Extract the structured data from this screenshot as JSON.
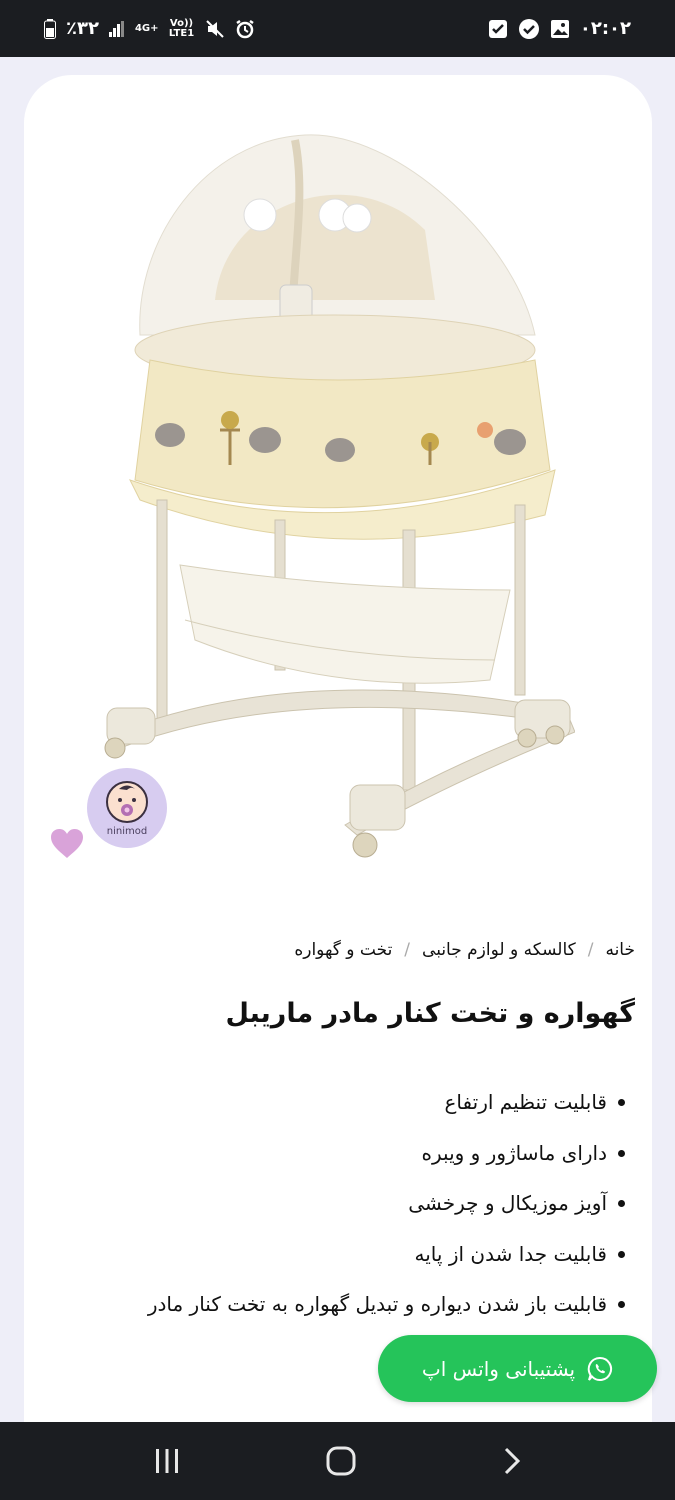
{
  "status_bar": {
    "battery_percent": "٪۳۲",
    "network": "4G+",
    "volte": "Vo)) LTE1",
    "time": "۰۲:۰۲"
  },
  "product": {
    "image_alt": "ninimod bassinet",
    "brand": "ninimod",
    "breadcrumb": [
      "خانه",
      "کالسکه و لوازم جانبی",
      "تخت و گهواره"
    ],
    "title": "گهواره و تخت کنار مادر ماریبل",
    "features": [
      "قابلیت تنظیم ارتفاع",
      "دارای ماساژور و ویبره",
      "آویز موزیکال و چرخشی",
      "قابلیت جدا شدن از پایه",
      "قابلیت باز شدن دیواره و تبدیل گهواره به تخت کنار مادر"
    ]
  },
  "whatsapp": {
    "label": "پشتیبانی واتس اپ"
  },
  "colors": {
    "whatsapp_green": "#25c45a",
    "heart": "#d9a3d9",
    "badge_bg": "#d7ccf0",
    "system_bar": "#1b1d21"
  },
  "icons": {
    "heart": "heart-icon",
    "whatsapp": "whatsapp-icon",
    "nav_recent": "recent-apps-icon",
    "nav_home": "home-icon",
    "nav_back": "back-icon"
  }
}
